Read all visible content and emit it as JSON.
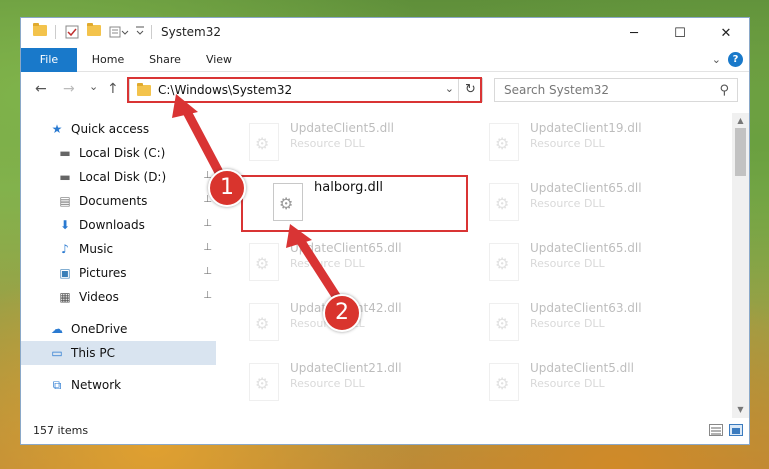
{
  "window": {
    "title": "System32",
    "controls": {
      "minimize": "─",
      "maximize": "☐",
      "close": "✕"
    }
  },
  "ribbon": {
    "tabs": [
      "File",
      "Home",
      "Share",
      "View"
    ],
    "help": "?"
  },
  "nav": {
    "back": "←",
    "forward": "→",
    "recent": "⌄",
    "up": "↑",
    "address": "C:\\Windows\\System32",
    "dropdown": "⌄",
    "refresh": "↻",
    "search_placeholder": "Search System32",
    "search_icon": "⚲"
  },
  "sidebar": {
    "items": [
      {
        "label": "Quick access",
        "icon": "star-icon",
        "glyph": "★",
        "pinned": false
      },
      {
        "label": "Local Disk (C:)",
        "icon": "drive-icon",
        "glyph": "▬",
        "pinned": false
      },
      {
        "label": "Local Disk (D:)",
        "icon": "drive-icon",
        "glyph": "▬",
        "pinned": true
      },
      {
        "label": "Documents",
        "icon": "documents-icon",
        "glyph": "▤",
        "pinned": true
      },
      {
        "label": "Downloads",
        "icon": "downloads-icon",
        "glyph": "⬇",
        "pinned": true
      },
      {
        "label": "Music",
        "icon": "music-icon",
        "glyph": "♪",
        "pinned": true
      },
      {
        "label": "Pictures",
        "icon": "pictures-icon",
        "glyph": "▣",
        "pinned": true
      },
      {
        "label": "Videos",
        "icon": "videos-icon",
        "glyph": "▦",
        "pinned": true
      },
      {
        "label": "OneDrive",
        "icon": "cloud-icon",
        "glyph": "☁",
        "pinned": false
      },
      {
        "label": "This PC",
        "icon": "computer-icon",
        "glyph": "▭",
        "pinned": false,
        "selected": true
      },
      {
        "label": "Network",
        "icon": "network-icon",
        "glyph": "⧉",
        "pinned": false
      }
    ],
    "pin_glyph": "📌"
  },
  "files": [
    {
      "name": "UpdateClient5.dll",
      "type": "Resource DLL",
      "faded": true
    },
    {
      "name": "UpdateClient19.dll",
      "type": "Resource DLL",
      "faded": true
    },
    {
      "name": "halborg.dll",
      "type": "",
      "faded": false,
      "highlighted": true
    },
    {
      "name": "UpdateClient65.dll",
      "type": "Resource DLL",
      "faded": true
    },
    {
      "name": "UpdateClient65.dll",
      "type": "Resource DLL",
      "faded": true
    },
    {
      "name": "UpdateClient65.dll",
      "type": "Resource DLL",
      "faded": true
    },
    {
      "name": "UpdateClient42.dll",
      "type": "Resource DLL",
      "faded": true
    },
    {
      "name": "UpdateClient63.dll",
      "type": "Resource DLL",
      "faded": true
    },
    {
      "name": "UpdateClient21.dll",
      "type": "Resource DLL",
      "faded": true
    },
    {
      "name": "UpdateClient5.dll",
      "type": "Resource DLL",
      "faded": true
    }
  ],
  "status": {
    "item_count": "157 items"
  },
  "annotations": {
    "step1": "1",
    "step2": "2",
    "color": "#d93434"
  }
}
